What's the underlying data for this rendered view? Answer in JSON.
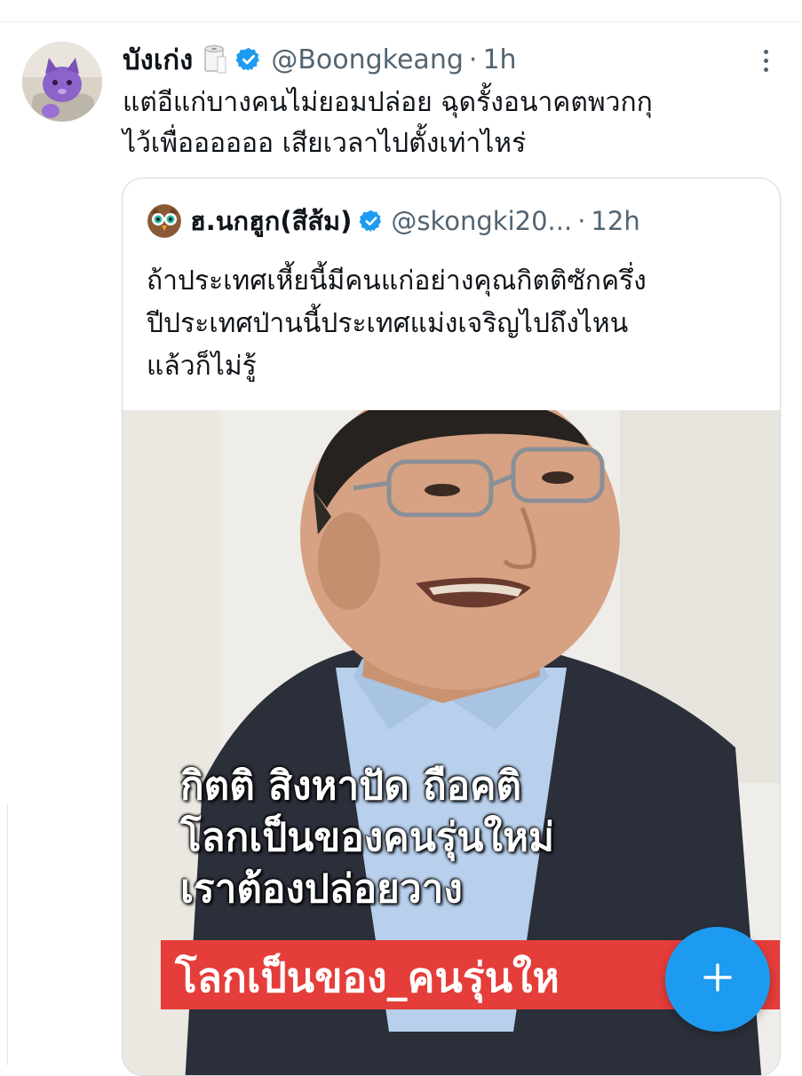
{
  "tweet": {
    "display_name": "บังเก่ง",
    "handle": "@Boongkeang",
    "separator": "·",
    "time": "1h",
    "text_lines": [
      "แต่อีแก่บางคนไม่ยอมปล่อย ฉุดรั้งอนาคตพวกกุ",
      "ไว้เพื่ออออออ เสียเวลาไปตั้งเท่าไหร่"
    ],
    "emoji_icon": "toilet-paper-icon",
    "verified_icon": "verified-badge-icon",
    "more_icon": "more-options-icon"
  },
  "quote": {
    "display_name": "ฮ.นกฮูก(สีส้ม)",
    "handle": "@skongki20...",
    "separator": "·",
    "time": "12h",
    "text_lines": [
      "ถ้าประเทศเหี้ยนี้มีคนแก่อย่างคุณกิตติซักครึ่ง",
      "ปีประเทศป่านนี้ประเทศแม่งเจริญไปถึงไหน",
      "แล้วก็ไม่รู้"
    ],
    "media": {
      "caption_lines": [
        "กิตติ สิงหาปัด ถือคติ",
        "โลกเป็นของคนรุ่นใหม่",
        "เราต้องปล่อยวาง"
      ],
      "banner_text": "โลกเป็นของ_คนรุ่นให"
    }
  },
  "fab": {
    "icon": "plus-icon"
  },
  "colors": {
    "accent": "#1d9bf0",
    "secondary_text": "#536471",
    "banner_red": "#e43d3a"
  }
}
